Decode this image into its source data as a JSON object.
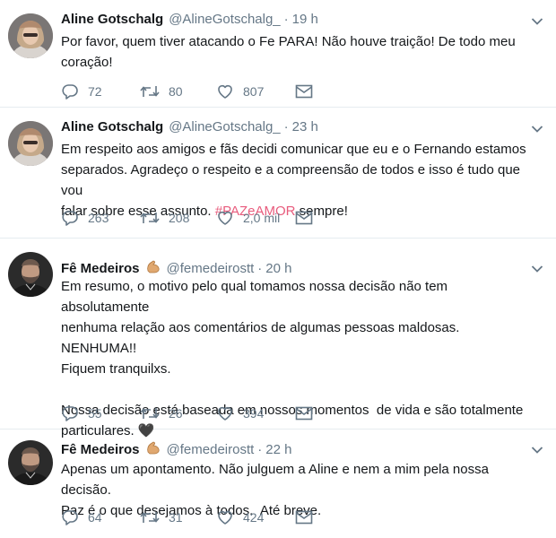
{
  "tweets": [
    {
      "name": "Aline Gotschalg",
      "handle": "@AlineGotschalg_",
      "time": "19 h",
      "text": "Por favor, quem tiver atacando o Fe PARA! Não houve traição! De todo meu\ncoração!",
      "replies": "72",
      "retweets": "80",
      "likes": "807"
    },
    {
      "name": "Aline Gotschalg",
      "handle": "@AlineGotschalg_",
      "time": "23 h",
      "text_before": "Em respeito aos amigos e fãs decidi comunicar que eu e o Fernando estamos\nseparados. Agradeço o respeito e a compreensão de todos e isso é tudo que vou\nfalar sobre esse assunto. ",
      "hashtag": "#PAZeAMOR",
      "text_after": " sempre!",
      "replies": "263",
      "retweets": "208",
      "likes": "2,0 mil"
    },
    {
      "name": "Fê Medeiros",
      "handle": "@femedeirostt",
      "time": "20 h",
      "text": "Em resumo, o motivo pelo qual tomamos nossa decisão não tem absolutamente\nnenhuma relação aos comentários de algumas pessoas maldosas. NENHUMA!!\nFiquem tranquilxs.\n\nNossa decisão está baseada em nossos momentos  de vida e são totalmente\nparticulares. 🖤",
      "replies": "55",
      "retweets": "26",
      "likes": "394"
    },
    {
      "name": "Fê Medeiros",
      "handle": "@femedeirostt",
      "time": "22 h",
      "text": "Apenas um apontamento. Não julguem a Aline e nem a mim pela nossa decisão.\nPaz é o que desejamos à todos.  Até breve.",
      "replies": "64",
      "retweets": "31",
      "likes": "424"
    }
  ],
  "icons": {
    "reply": "reply-icon",
    "retweet": "retweet-icon",
    "like": "heart-icon",
    "dm": "envelope-icon",
    "caret": "chevron-down-icon",
    "emoji": "muscle-emoji-icon"
  },
  "colors": {
    "text": "#14171a",
    "secondary": "#657786",
    "hashtag": "#e85c7d",
    "divider": "#e6ecf0"
  }
}
